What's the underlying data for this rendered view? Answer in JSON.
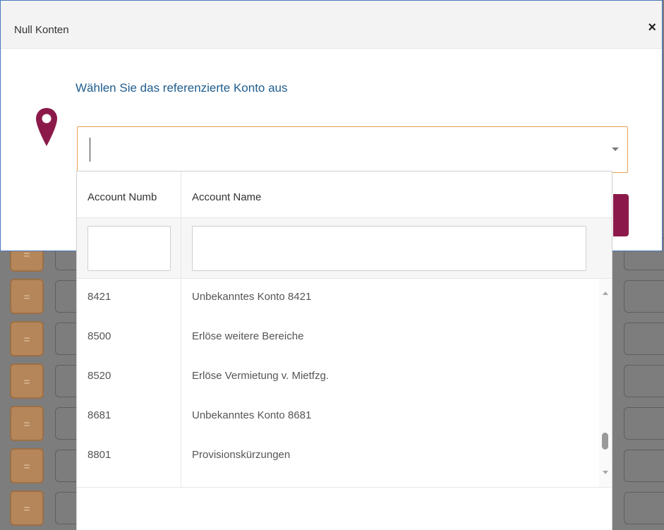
{
  "modal": {
    "title": "Null Konten",
    "close_label": "×",
    "prompt": "Wählen Sie das referenzierte Konto aus",
    "icon": "map-pin-icon"
  },
  "combo": {
    "value": "",
    "placeholder": ""
  },
  "grid": {
    "columns": [
      "Account Numb",
      "Account Name"
    ],
    "filter_account_number": "",
    "filter_account_name": "",
    "rows": [
      {
        "number": "8421",
        "name": "Unbekanntes Konto 8421"
      },
      {
        "number": "8500",
        "name": "Erlöse weitere Bereiche"
      },
      {
        "number": "8520",
        "name": "Erlöse Vermietung v. Mietfzg."
      },
      {
        "number": "8681",
        "name": "Unbekanntes Konto 8681"
      },
      {
        "number": "8801",
        "name": "Provisionskürzungen"
      }
    ]
  },
  "background": {
    "row_button_label": "="
  },
  "colors": {
    "accent_pin": "#8b1a4a",
    "prompt_text": "#1f5d8f",
    "combo_focus_border": "#e8a150",
    "row_button": "#b5865a"
  }
}
